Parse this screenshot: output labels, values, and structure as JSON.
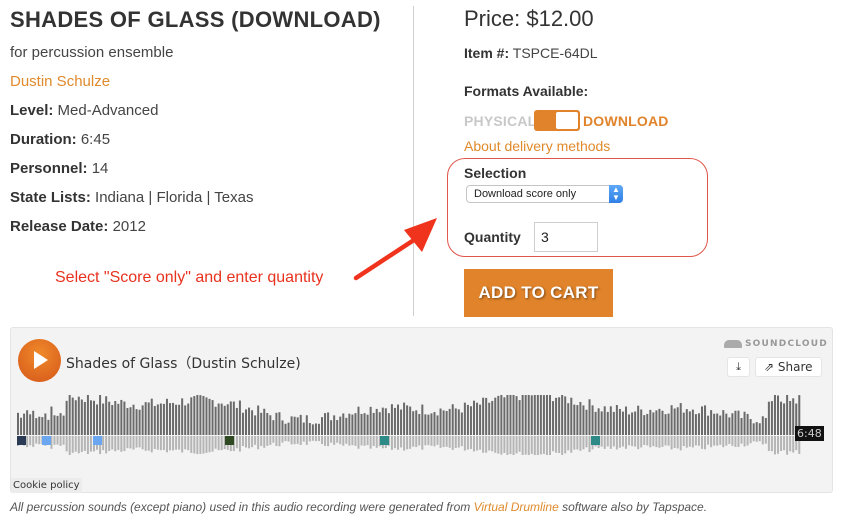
{
  "product": {
    "title": "SHADES OF GLASS (DOWNLOAD)",
    "subtitle": "for percussion ensemble",
    "composer": "Dustin Schulze",
    "meta": [
      {
        "label": "Level:",
        "value": "Med-Advanced"
      },
      {
        "label": "Duration:",
        "value": "6:45"
      },
      {
        "label": "Personnel:",
        "value": "14"
      },
      {
        "label": "State Lists:",
        "value": "Indiana | Florida | Texas"
      },
      {
        "label": "Release Date:",
        "value": "2012"
      }
    ]
  },
  "annotation": {
    "text": "Select \"Score only\" and enter quantity",
    "color": "#e8321e"
  },
  "purchase": {
    "price": "Price: $12.00",
    "item_label": "Item #:",
    "item_value": "TSPCE-64DL",
    "formats_label": "Formats Available:",
    "format_off": "PHYSICAL",
    "format_on": "DOWNLOAD",
    "format_selected": "DOWNLOAD",
    "delivery_link": "About delivery methods",
    "selection_label": "Selection",
    "selection_value": "Download score only",
    "quantity_label": "Quantity",
    "quantity_value": "3",
    "add_to_cart": "ADD TO CART",
    "accent_color": "#e0832a"
  },
  "player": {
    "track_title": "Shades of Glass（Dustin Schulze)",
    "brand": "SOUNDCLOUD",
    "share_label": "Share",
    "duration": "6:48",
    "cookie_policy": "Cookie policy"
  },
  "footnote": {
    "before": "All percussion sounds (except piano) used in this audio recording were generated from ",
    "link": "Virtual Drumline",
    "after": " software also by Tapspace."
  }
}
